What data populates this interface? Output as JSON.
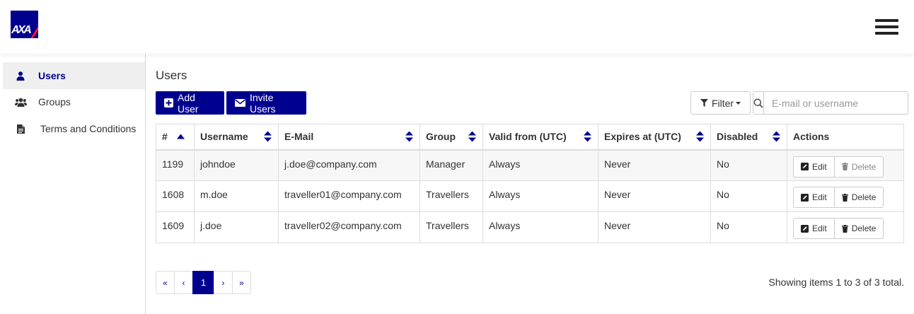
{
  "brand": {
    "logo_text": "AXA",
    "accent": "#00008f",
    "logo_slash_color": "#ff1721"
  },
  "sidebar": {
    "items": [
      {
        "label": "Users",
        "icon": "user-icon",
        "active": true
      },
      {
        "label": "Groups",
        "icon": "users-group-icon",
        "active": false
      },
      {
        "label": "Terms and Conditions",
        "icon": "document-icon",
        "active": false
      }
    ]
  },
  "main": {
    "title": "Users",
    "add_user_label": "Add User",
    "invite_users_label": "Invite Users",
    "filter_label": "Filter",
    "search_placeholder": "E-mail or username"
  },
  "table": {
    "columns": [
      "#",
      "Username",
      "E-Mail",
      "Group",
      "Valid from (UTC)",
      "Expires at (UTC)",
      "Disabled",
      "Actions"
    ],
    "rows": [
      {
        "id": "1199",
        "username": "johndoe",
        "email": "j.doe@company.com",
        "group": "Manager",
        "valid_from": "Always",
        "expires_at": "Never",
        "disabled": "No",
        "delete_enabled": false
      },
      {
        "id": "1608",
        "username": "m.doe",
        "email": "traveller01@company.com",
        "group": "Travellers",
        "valid_from": "Always",
        "expires_at": "Never",
        "disabled": "No",
        "delete_enabled": true
      },
      {
        "id": "1609",
        "username": "j.doe",
        "email": "traveller02@company.com",
        "group": "Travellers",
        "valid_from": "Always",
        "expires_at": "Never",
        "disabled": "No",
        "delete_enabled": true
      }
    ],
    "edit_label": "Edit",
    "delete_label": "Delete"
  },
  "pagination": {
    "first": "«",
    "prev": "‹",
    "current": "1",
    "next": "›",
    "last": "»",
    "summary": "Showing items 1 to 3 of 3 total."
  }
}
